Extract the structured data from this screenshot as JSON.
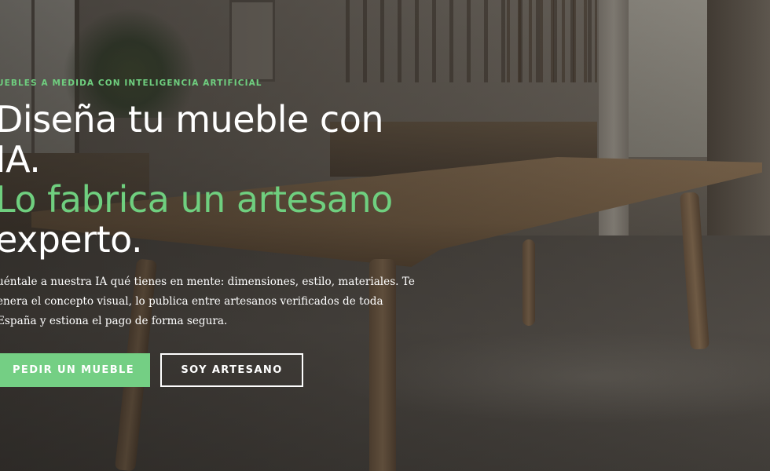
{
  "hero": {
    "eyebrow": "uebles a medida con inteligencia artificial",
    "headline": {
      "line1": "Diseña tu mueble con",
      "line2": "IA.",
      "line3": "Lo fabrica un artesano",
      "line4": "experto."
    },
    "description": "uéntale a nuestra IA qué tienes en mente: dimensiones, estilo, materiales. Te enera el concepto visual, lo publica entre artesanos verificados de toda España y estiona el pago de forma segura.",
    "buttons": {
      "primary": "PEDIR UN MUEBLE",
      "secondary": "SOY ARTESANO"
    }
  },
  "colors": {
    "accent": "#6fcf7f",
    "button_primary": "#74cf84",
    "text": "#ffffff"
  }
}
